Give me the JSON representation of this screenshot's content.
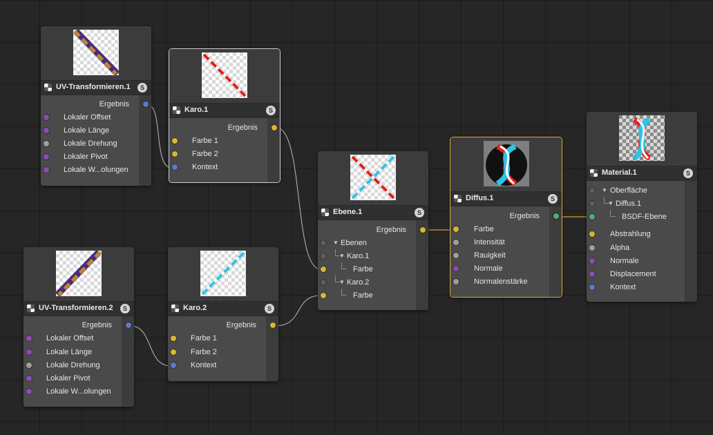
{
  "nodes": {
    "uv1": {
      "title": "UV-Transformieren.1",
      "output": "Ergebnis",
      "inputs": [
        "Lokaler Offset",
        "Lokale Länge",
        "Lokale Drehung",
        "Lokaler Pivot",
        "Lokale W...olungen"
      ]
    },
    "uv2": {
      "title": "UV-Transformieren.2",
      "output": "Ergebnis",
      "inputs": [
        "Lokaler Offset",
        "Lokale Länge",
        "Lokale Drehung",
        "Lokaler Pivot",
        "Lokale W...olungen"
      ]
    },
    "karo1": {
      "title": "Karo.1",
      "output": "Ergebnis",
      "inputs": [
        "Farbe 1",
        "Farbe 2",
        "Kontext"
      ]
    },
    "karo2": {
      "title": "Karo.2",
      "output": "Ergebnis",
      "inputs": [
        "Farbe 1",
        "Farbe 2",
        "Kontext"
      ]
    },
    "ebene1": {
      "title": "Ebene.1",
      "output": "Ergebnis",
      "tree": [
        "Ebenen",
        "Karo.1",
        "Farbe",
        "Karo.2",
        "Farbe"
      ]
    },
    "diffus1": {
      "title": "Diffus.1",
      "output": "Ergebnis",
      "inputs": [
        "Farbe",
        "Intensität",
        "Rauigkeit",
        "Normale",
        "Normalenstärke"
      ]
    },
    "material1": {
      "title": "Material.1",
      "tree": [
        "Oberfläche",
        "Diffus.1",
        "BSDF-Ebene"
      ],
      "inputs": [
        "Abstrahlung",
        "Alpha",
        "Normale",
        "Displacement",
        "Kontext"
      ]
    }
  },
  "s_badge": "S",
  "colors": {
    "port_purple": "#8c4cb2",
    "port_grey": "#a0a0a0",
    "port_blue": "#5f79c9",
    "port_yellow": "#d8b634",
    "port_green": "#4cb07a",
    "selection_orange": "#e0a531",
    "stripe_red": "#e0201c",
    "stripe_cyan": "#2ec2e8"
  }
}
